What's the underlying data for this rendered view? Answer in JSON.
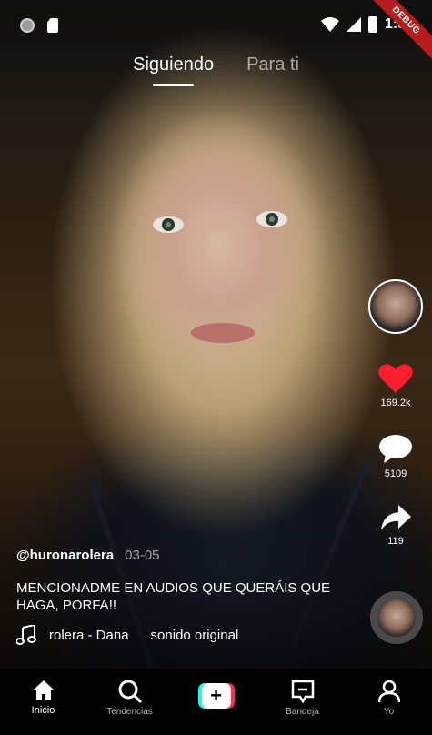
{
  "status_bar": {
    "time": "1:54",
    "debug_label": "DEBUG"
  },
  "tabs": [
    {
      "label": "Siguiendo",
      "active": true
    },
    {
      "label": "Para ti",
      "active": false
    }
  ],
  "actions": {
    "likes": "169.2k",
    "comments": "5109",
    "shares": "119",
    "like_color": "#ff1d2e"
  },
  "post": {
    "handle": "@huronarolera",
    "date": "03-05",
    "description": "MENCIONADME EN AUDIOS QUE QUERÁIS QUE HAGA, PORFA!!",
    "sound_artist": "rolera - Dana",
    "sound_name": "sonido original"
  },
  "bottom_nav": [
    {
      "label": "Inicio",
      "icon": "home-icon",
      "active": true
    },
    {
      "label": "Tendencias",
      "icon": "search-icon",
      "active": false
    },
    {
      "label": "",
      "icon": "create-icon",
      "active": false
    },
    {
      "label": "Bandeja",
      "icon": "inbox-icon",
      "active": false
    },
    {
      "label": "Yo",
      "icon": "profile-icon",
      "active": false
    }
  ],
  "colors": {
    "create_cyan": "#25f4ee",
    "create_red": "#fe2c55",
    "background": "#000000"
  }
}
